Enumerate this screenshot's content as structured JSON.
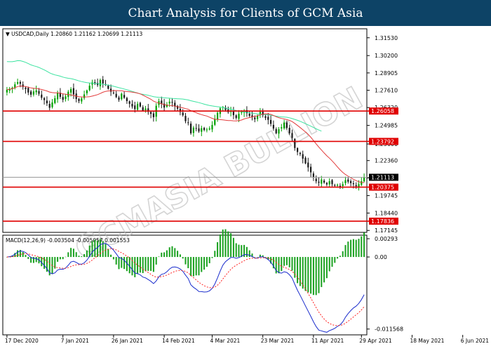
{
  "banner": {
    "title": "Chart Analysis for Clients of GCM Asia"
  },
  "watermark": "GCMASIA BULLION",
  "colors": {
    "up": "#00a000",
    "down": "#1a1a1a",
    "sma_short": "#e23b3b",
    "sma_long": "#3ce3a0",
    "level": "#e00000",
    "macd_line": "#1a2ccc",
    "signal_line": "#ff2020",
    "hist": "#19a11f"
  },
  "chart_data": [
    {
      "type": "line",
      "title": "USDCAD,Daily",
      "ohlc": {
        "open": "1.20860",
        "high": "1.21162",
        "low": "1.20699",
        "close": "1.21113"
      },
      "ylim": [
        1.17,
        1.322
      ],
      "y_ticks": [
        "1.31530",
        "1.30200",
        "1.28905",
        "1.27610",
        "1.26320",
        "1.24985",
        "1.23600",
        "1.22360",
        "1.21070",
        "1.19745",
        "1.18440",
        "1.17145"
      ],
      "x_labels": [
        {
          "label": "17 Dec 2020",
          "day": 0
        },
        {
          "label": "7 Jan 2021",
          "day": 21
        },
        {
          "label": "26 Jan 2021",
          "day": 40
        },
        {
          "label": "14 Feb 2021",
          "day": 59
        },
        {
          "label": "4 Mar 2021",
          "day": 77
        },
        {
          "label": "23 Mar 2021",
          "day": 96
        },
        {
          "label": "11 Apr 2021",
          "day": 115
        },
        {
          "label": "29 Apr 2021",
          "day": 133
        },
        {
          "label": "18 May 2021",
          "day": 152
        },
        {
          "label": "6 Jun 2021",
          "day": 171
        }
      ],
      "closes": [
        1.2765,
        1.2772,
        1.278,
        1.2805,
        1.2822,
        1.281,
        1.2786,
        1.277,
        1.2744,
        1.2728,
        1.2752,
        1.276,
        1.2735,
        1.2705,
        1.2688,
        1.2664,
        1.263,
        1.267,
        1.2702,
        1.274,
        1.2712,
        1.269,
        1.2715,
        1.275,
        1.277,
        1.273,
        1.2696,
        1.268,
        1.27,
        1.273,
        1.276,
        1.2795,
        1.282,
        1.281,
        1.28,
        1.2838,
        1.2812,
        1.2804,
        1.2772,
        1.275,
        1.2738,
        1.271,
        1.269,
        1.2735,
        1.2705,
        1.268,
        1.266,
        1.264,
        1.262,
        1.266,
        1.264,
        1.261,
        1.2625,
        1.26,
        1.2585,
        1.256,
        1.2645,
        1.268,
        1.266,
        1.2632,
        1.2654,
        1.2676,
        1.2668,
        1.264,
        1.2623,
        1.26,
        1.2575,
        1.253,
        1.252,
        1.244,
        1.2482
      ],
      "closes_late": [
        1.2478,
        1.2454,
        1.2478,
        1.2465,
        1.2468,
        1.2476,
        1.2502,
        1.2545,
        1.2593,
        1.2626,
        1.2636,
        1.2614,
        1.2598,
        1.2605,
        1.2575,
        1.2554,
        1.2585,
        1.2598,
        1.261,
        1.259,
        1.257,
        1.256,
        1.2545,
        1.257,
        1.26,
        1.2575,
        1.2555,
        1.254,
        1.251,
        1.2475,
        1.244,
        1.247,
        1.2485,
        1.252,
        1.248,
        1.244,
        1.2405,
        1.233,
        1.23,
        1.2285,
        1.225,
        1.2215,
        1.2185,
        1.2148,
        1.2108,
        1.2082,
        1.207,
        1.2095,
        1.2072,
        1.2058,
        1.2082,
        1.206,
        1.2052,
        1.2055,
        1.204,
        1.206,
        1.209,
        1.2078,
        1.2068,
        1.206,
        1.2044,
        1.206,
        1.2082,
        1.2111
      ],
      "levels": [
        {
          "price": 1.26058,
          "label": "1.26058"
        },
        {
          "price": 1.23792,
          "label": "1.23792"
        },
        {
          "price": 1.20375,
          "label": "1.20375"
        },
        {
          "price": 1.17836,
          "label": "1.17836"
        }
      ],
      "current": {
        "price": 1.21113,
        "label": "1.21113"
      },
      "series": []
    },
    {
      "type": "line",
      "title": "MACD(12,26,9)",
      "values_text": "-0.003504 -0.005057 0.001553",
      "ylim": [
        -0.0125,
        0.0035
      ],
      "y_ticks": [
        "0.00293",
        "0.00",
        "-0.011568"
      ],
      "series": []
    }
  ]
}
